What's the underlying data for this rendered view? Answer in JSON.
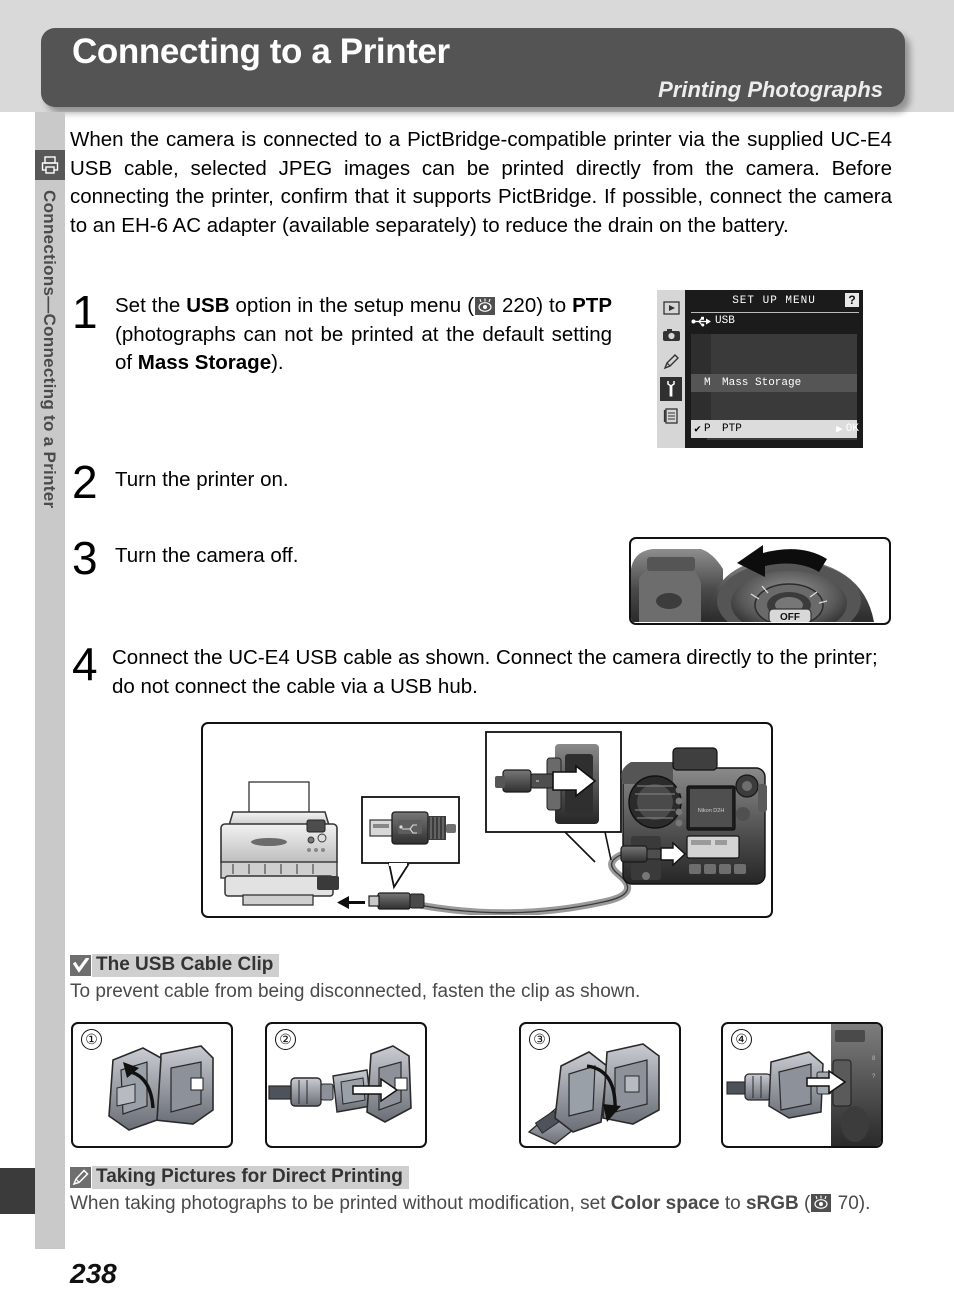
{
  "header": {
    "title": "Connecting to a Printer",
    "subtitle": "Printing Photographs"
  },
  "sidebar": {
    "icon": "printer-icon",
    "label": "Connections—Connecting to a Printer"
  },
  "intro": "When the camera is connected to a PictBridge-compatible printer via the supplied UC-E4 USB cable, selected JPEG images can be printed directly from the camera.  Before connecting the printer, confirm that it supports PictBridge.  If possible, connect the camera to an EH-6 AC adapter (available separately) to reduce the drain on the battery.",
  "steps": [
    {
      "number": "1",
      "text_parts": {
        "p1": "Set the ",
        "b1": "USB",
        "p2": " option in the setup menu (",
        "ref": " 220) to ",
        "b2": "PTP",
        "p3": " (photographs can not be printed at the default setting of ",
        "b3": "Mass Storage",
        "p4": ")."
      }
    },
    {
      "number": "2",
      "text": "Turn the printer on."
    },
    {
      "number": "3",
      "text": "Turn the camera off."
    },
    {
      "number": "4",
      "text": "Connect the UC-E4 USB cable as shown.  Connect the camera directly to the printer; do not connect the cable via a USB hub."
    }
  ],
  "lcd": {
    "title": "SET UP MENU",
    "help_badge": "?",
    "usb_label": "USB",
    "rows": [
      {
        "check": "",
        "code": "M",
        "label": "Mass Storage"
      },
      {
        "check": "✔",
        "code": "P",
        "label": "PTP"
      }
    ],
    "ok_arrow": "▶",
    "ok_label": "OK",
    "side_icons": [
      "playback-icon",
      "shooting-menu-icon",
      "custom-settings-pencil-icon",
      "setup-menu-wrench-icon",
      "recent-settings-icon"
    ]
  },
  "dial_illustration": {
    "name": "power-switch-off-illustration",
    "switch_label": "OFF"
  },
  "connection_illustration": {
    "name": "camera-to-printer-usb-connection-illustration"
  },
  "notes": [
    {
      "badge": "warning-check-icon",
      "title": "The USB Cable Clip",
      "body": "To prevent cable from being disconnected, fasten the clip as shown."
    },
    {
      "badge": "pencil-note-icon",
      "title": "Taking Pictures for Direct Printing",
      "body_parts": {
        "p1": "When taking photographs to be printed without modification, set ",
        "b1": "Color space",
        "p2": " to ",
        "b2": "sRGB",
        "p3": " (",
        "ref": " 70)."
      }
    }
  ],
  "clip_steps": [
    {
      "number": "①",
      "name": "clip-open-illustration"
    },
    {
      "number": "②",
      "name": "clip-insert-cable-illustration"
    },
    {
      "number": "③",
      "name": "clip-close-illustration"
    },
    {
      "number": "④",
      "name": "clip-attach-to-camera-illustration"
    }
  ],
  "page_number": "238",
  "colors": {
    "header_bg": "#545454",
    "band_bg": "#d9d9d9",
    "sidebar_bg": "#c9c9c9",
    "note_title_bg": "#cfcfcf",
    "badge_bg": "#6e6e6e"
  }
}
